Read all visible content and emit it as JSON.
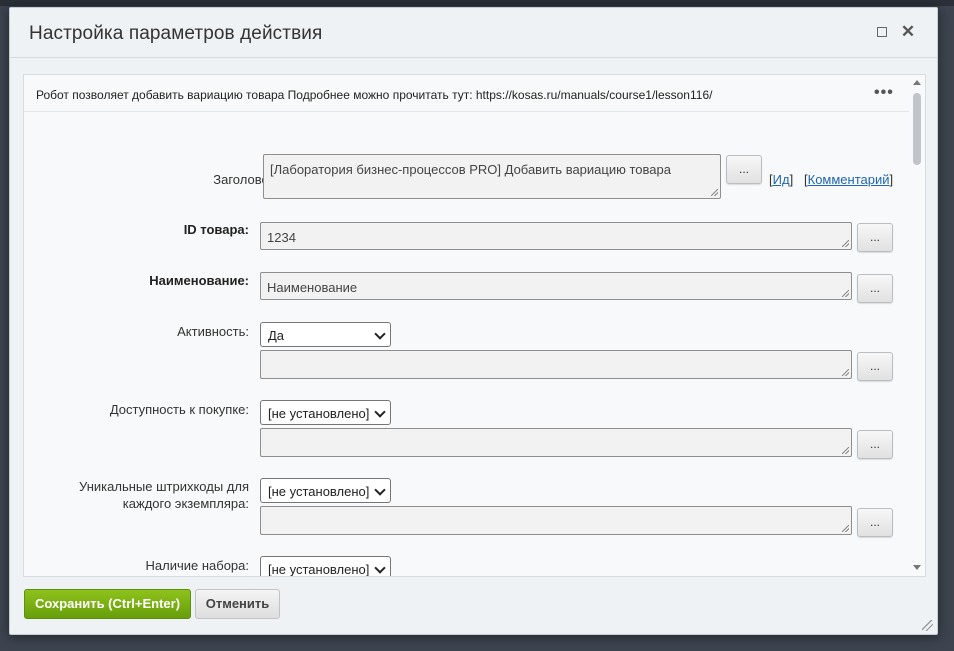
{
  "dialog": {
    "title": "Настройка параметров действия",
    "description": "Робот позволяет добавить вариацию товара Подробнее можно прочитать тут: https://kosas.ru/manuals/course1/lesson116/",
    "menu_icon": "more-dots-icon",
    "maximize_icon": "maximize-icon",
    "close_icon": "close-icon"
  },
  "fields": {
    "title": {
      "label": "Заголовок:",
      "value": "[Лаборатория бизнес-процессов PRO] Добавить вариацию товара",
      "button": "...",
      "link_id": "Ид",
      "link_comment": "Комментарий"
    },
    "product_id": {
      "label": "ID товара:",
      "value": "1234",
      "button": "..."
    },
    "name": {
      "label": "Наименование:",
      "value": "Наименование",
      "button": "..."
    },
    "active": {
      "label": "Активность:",
      "selected": "Да",
      "value": "",
      "button": "..."
    },
    "purchase": {
      "label": "Доступность к покупке:",
      "selected": "[не установлено]",
      "value": "",
      "button": "..."
    },
    "barcodes": {
      "label_line1": "Уникальные штрихкоды для",
      "label_line2": "каждого экземпляра:",
      "selected": "[не установлено]",
      "value": "",
      "button": "..."
    },
    "bundle": {
      "label": "Наличие набора:",
      "selected": "[не установлено]"
    }
  },
  "footer": {
    "save_label": "Сохранить (Ctrl+Enter)",
    "cancel_label": "Отменить"
  },
  "colors": {
    "save_button": "#79b114",
    "link": "#2067b0",
    "background": "#3d4450"
  }
}
